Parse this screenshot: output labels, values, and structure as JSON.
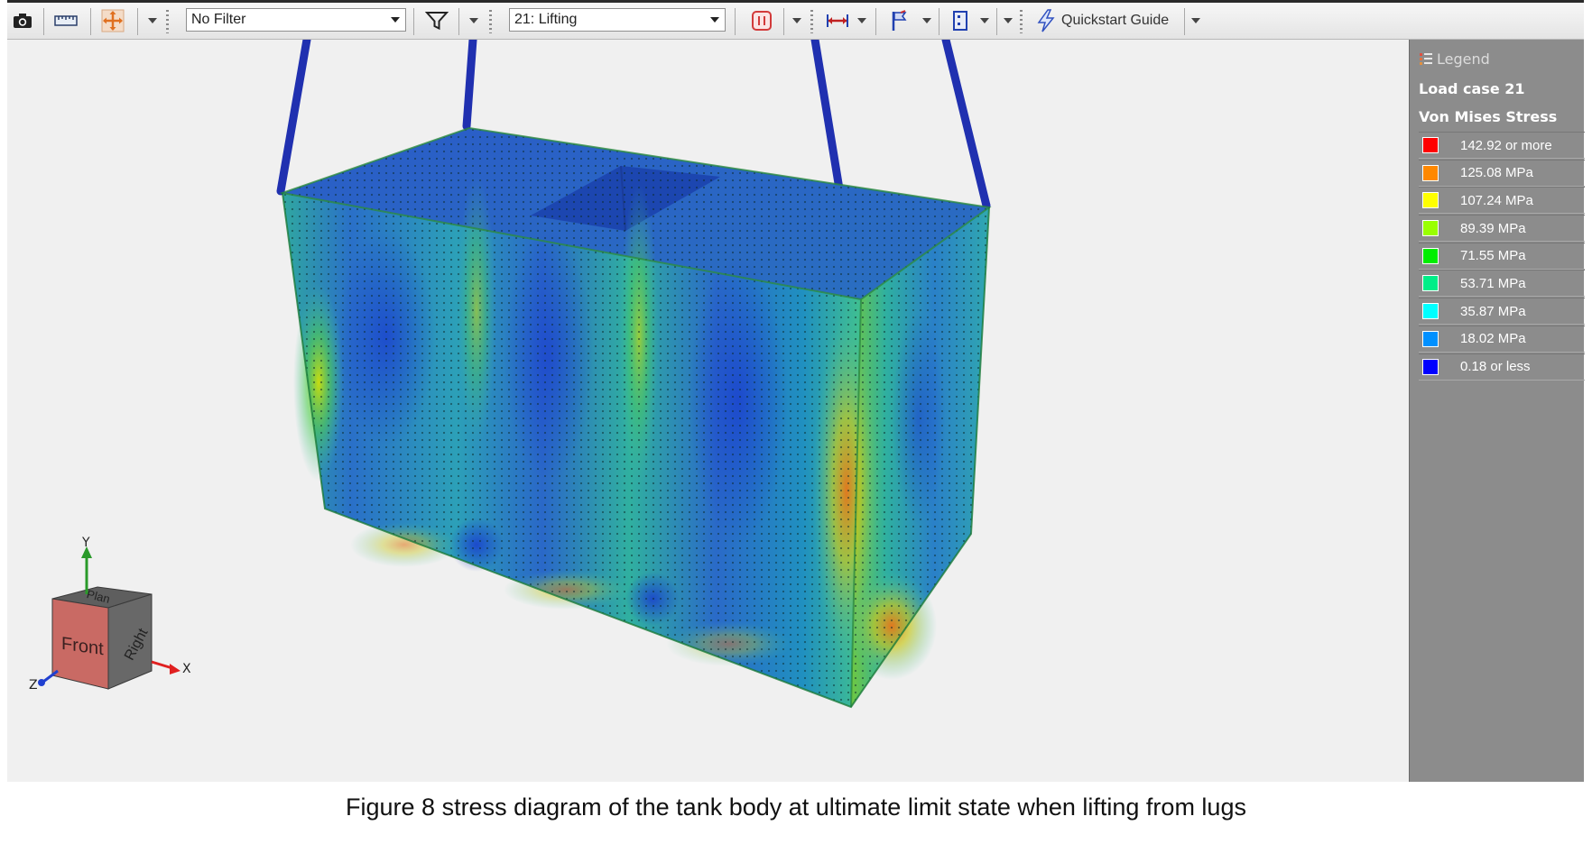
{
  "toolbar": {
    "filter_value": "No Filter",
    "loadcase_value": "21: Lifting",
    "quickstart_label": "Quickstart Guide",
    "icons": [
      "camera-icon",
      "ruler-icon",
      "move-icon",
      "filter-icon",
      "stop-icon",
      "dimension-icon",
      "flag-icon",
      "node-icon",
      "lightning-icon"
    ]
  },
  "legend": {
    "header": "Legend",
    "title": "Load case 21",
    "subtitle": "Von Mises Stress",
    "items": [
      {
        "color": "#ff0000",
        "label": "142.92 or more"
      },
      {
        "color": "#ff8800",
        "label": "125.08 MPa"
      },
      {
        "color": "#ffff00",
        "label": "107.24 MPa"
      },
      {
        "color": "#99ff00",
        "label": "89.39 MPa"
      },
      {
        "color": "#00ee00",
        "label": "71.55 MPa"
      },
      {
        "color": "#00ee88",
        "label": "53.71 MPa"
      },
      {
        "color": "#00ffff",
        "label": "35.87 MPa"
      },
      {
        "color": "#0090ff",
        "label": "18.02 MPa"
      },
      {
        "color": "#0000ff",
        "label": "0.18 or less"
      }
    ]
  },
  "viewcube": {
    "face_front": "Front",
    "face_right": "Right",
    "face_top": "Plan",
    "axis_x": "X",
    "axis_y": "Y",
    "axis_z": "Z"
  },
  "caption": "Figure 8 stress diagram of the tank body at ultimate limit state when lifting from lugs"
}
